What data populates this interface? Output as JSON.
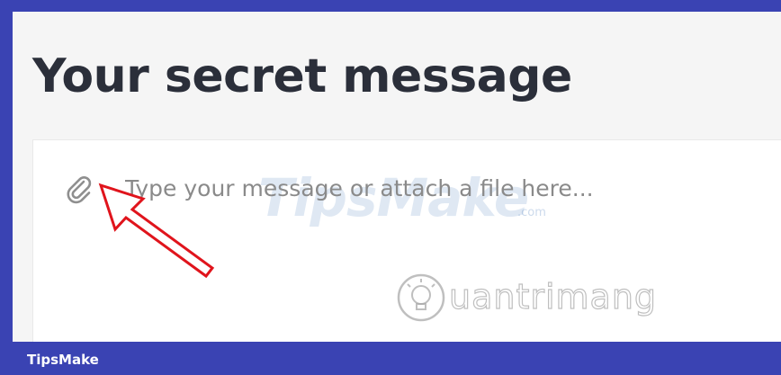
{
  "page": {
    "title": "Your secret message"
  },
  "composer": {
    "placeholder": "Type your message or attach a file here...",
    "attach_icon": "paperclip-icon"
  },
  "watermarks": {
    "tipsmake": "TipsMake",
    "tipsmake_suffix": ".com",
    "quantrimang": "uantrimang"
  },
  "footer": {
    "brand": "TipsMake"
  },
  "colors": {
    "frame_border": "#3a43b3",
    "page_background": "#f5f5f5",
    "title": "#2b2f3a",
    "placeholder": "#8a8a8a",
    "arrow": "#e0141c"
  }
}
